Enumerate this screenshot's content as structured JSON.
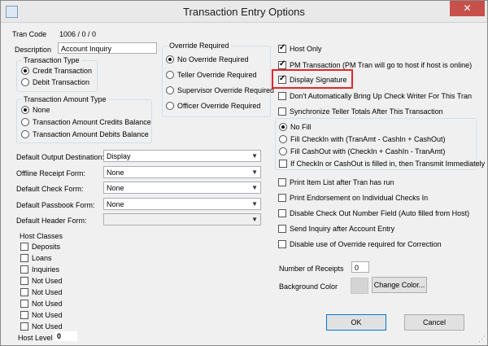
{
  "window": {
    "title": "Transaction Entry Options",
    "close_glyph": "✕"
  },
  "tran_code": {
    "label": "Tran Code",
    "value": "1006 / 0 / 0"
  },
  "description": {
    "label": "Description",
    "value": "Account Inquiry"
  },
  "transaction_type": {
    "title": "Transaction Type",
    "options": [
      {
        "label": "Credit Transaction",
        "selected": true
      },
      {
        "label": "Debit Transaction",
        "selected": false
      }
    ]
  },
  "transaction_amount_type": {
    "title": "Transaction Amount Type",
    "options": [
      {
        "label": "None",
        "selected": true
      },
      {
        "label": "Transaction Amount Credits Balance",
        "selected": false
      },
      {
        "label": "Transaction Amount Debits Balance",
        "selected": false
      }
    ]
  },
  "override_required": {
    "title": "Override Required",
    "options": [
      {
        "label": "No Override Required",
        "selected": true
      },
      {
        "label": "Teller Override Required",
        "selected": false
      },
      {
        "label": "Supervisor Override Required",
        "selected": false
      },
      {
        "label": "Officer Override Required",
        "selected": false
      }
    ]
  },
  "right_checks_top": [
    {
      "label": "Host Only",
      "checked": true
    },
    {
      "label": "PM Transaction (PM Tran will go to host if host is online)",
      "checked": true
    },
    {
      "label": "Display Signature",
      "checked": true
    },
    {
      "label": "Don't Automatically Bring Up Check Writer For This Tran",
      "checked": false
    },
    {
      "label": "Synchronize Teller Totals After This Transaction",
      "checked": false
    }
  ],
  "fill_options": {
    "options": [
      {
        "label": "No Fill",
        "selected": true
      },
      {
        "label": "Fill CheckIn with (TranAmt - CashIn + CashOut)",
        "selected": false
      },
      {
        "label": "Fill CashOut with (CheckIn + CashIn - TranAmt)",
        "selected": false
      }
    ],
    "transmit_check": {
      "label": "If CheckIn or CashOut is filled in, then Transmit Immediately",
      "checked": false
    }
  },
  "right_checks_bottom": [
    {
      "label": "Print Item List after Tran has run",
      "checked": false
    },
    {
      "label": "Print Endorsement on Individual Checks In",
      "checked": false
    },
    {
      "label": "Disable Check Out Number Field (Auto filled from Host)",
      "checked": false
    },
    {
      "label": "Send Inquiry after Account Entry",
      "checked": false
    },
    {
      "label": "Disable use of Override required for Correction",
      "checked": false
    }
  ],
  "dropdowns": [
    {
      "label": "Default Output Destination:",
      "value": "Display"
    },
    {
      "label": "Offline Receipt Form:",
      "value": "None"
    },
    {
      "label": "Default Check Form:",
      "value": "None"
    },
    {
      "label": "Default Passbook Form:",
      "value": "None"
    },
    {
      "label": "Default Header Form:",
      "value": ""
    }
  ],
  "host_classes": {
    "title": "Host Classes",
    "items": [
      {
        "label": "Deposits",
        "checked": false
      },
      {
        "label": "Loans",
        "checked": false
      },
      {
        "label": "Inquiries",
        "checked": false
      },
      {
        "label": "Not Used",
        "checked": false
      },
      {
        "label": "Not Used",
        "checked": false
      },
      {
        "label": "Not Used",
        "checked": false
      },
      {
        "label": "Not Used",
        "checked": false
      },
      {
        "label": "Not Used",
        "checked": false
      }
    ]
  },
  "host_level": {
    "label": "Host Level",
    "value": "0"
  },
  "receipts": {
    "label": "Number of Receipts",
    "value": "0"
  },
  "background_color": {
    "label": "Background Color",
    "button_label": "Change Color...",
    "swatch": "#d4d4d4"
  },
  "buttons": {
    "ok": "OK",
    "cancel": "Cancel"
  },
  "highlight_color": "#e0262e"
}
